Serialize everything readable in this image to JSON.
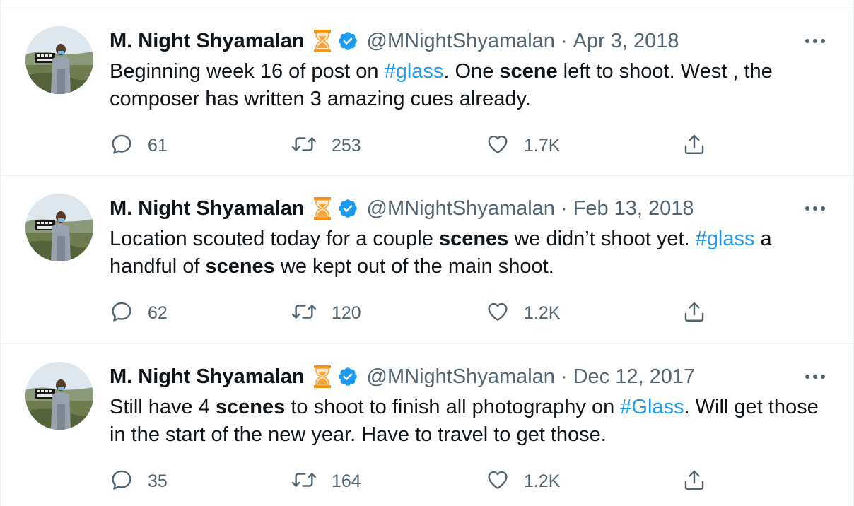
{
  "colors": {
    "text": "#0f1419",
    "muted": "#536471",
    "link": "#1d9bf0",
    "verified": "#1d9bf0",
    "hourglass": "#f4a53a",
    "border": "#eff3f4"
  },
  "tweets": [
    {
      "author_name": "M. Night Shyamalan",
      "emoji": "hourglass-icon",
      "verified": true,
      "handle": "@MNightShyamalan",
      "separator": "·",
      "date": "Apr 3, 2018",
      "segments": [
        {
          "text": "Beginning week 16 of post on ",
          "style": "plain"
        },
        {
          "text": "#glass",
          "style": "hashtag"
        },
        {
          "text": ". One ",
          "style": "plain"
        },
        {
          "text": "scene",
          "style": "bold"
        },
        {
          "text": " left to shoot. West , the composer has written 3 amazing cues already.",
          "style": "plain"
        }
      ],
      "replies": "61",
      "retweets": "253",
      "likes": "1.7K"
    },
    {
      "author_name": "M. Night Shyamalan",
      "emoji": "hourglass-icon",
      "verified": true,
      "handle": "@MNightShyamalan",
      "separator": "·",
      "date": "Feb 13, 2018",
      "segments": [
        {
          "text": "Location scouted today for a couple ",
          "style": "plain"
        },
        {
          "text": "scenes",
          "style": "bold"
        },
        {
          "text": " we didn’t shoot yet. ",
          "style": "plain"
        },
        {
          "text": "#glass",
          "style": "hashtag"
        },
        {
          "text": " a handful of ",
          "style": "plain"
        },
        {
          "text": "scenes",
          "style": "bold"
        },
        {
          "text": " we kept out of the main shoot.",
          "style": "plain"
        }
      ],
      "replies": "62",
      "retweets": "120",
      "likes": "1.2K"
    },
    {
      "author_name": "M. Night Shyamalan",
      "emoji": "hourglass-icon",
      "verified": true,
      "handle": "@MNightShyamalan",
      "separator": "·",
      "date": "Dec 12, 2017",
      "segments": [
        {
          "text": "Still have 4 ",
          "style": "plain"
        },
        {
          "text": "scenes",
          "style": "bold"
        },
        {
          "text": " to shoot to finish all photography on ",
          "style": "plain"
        },
        {
          "text": "#Glass",
          "style": "hashtag"
        },
        {
          "text": ". Will get those in the start of the new year. Have to travel to get those.",
          "style": "plain"
        }
      ],
      "replies": "35",
      "retweets": "164",
      "likes": "1.2K"
    }
  ]
}
